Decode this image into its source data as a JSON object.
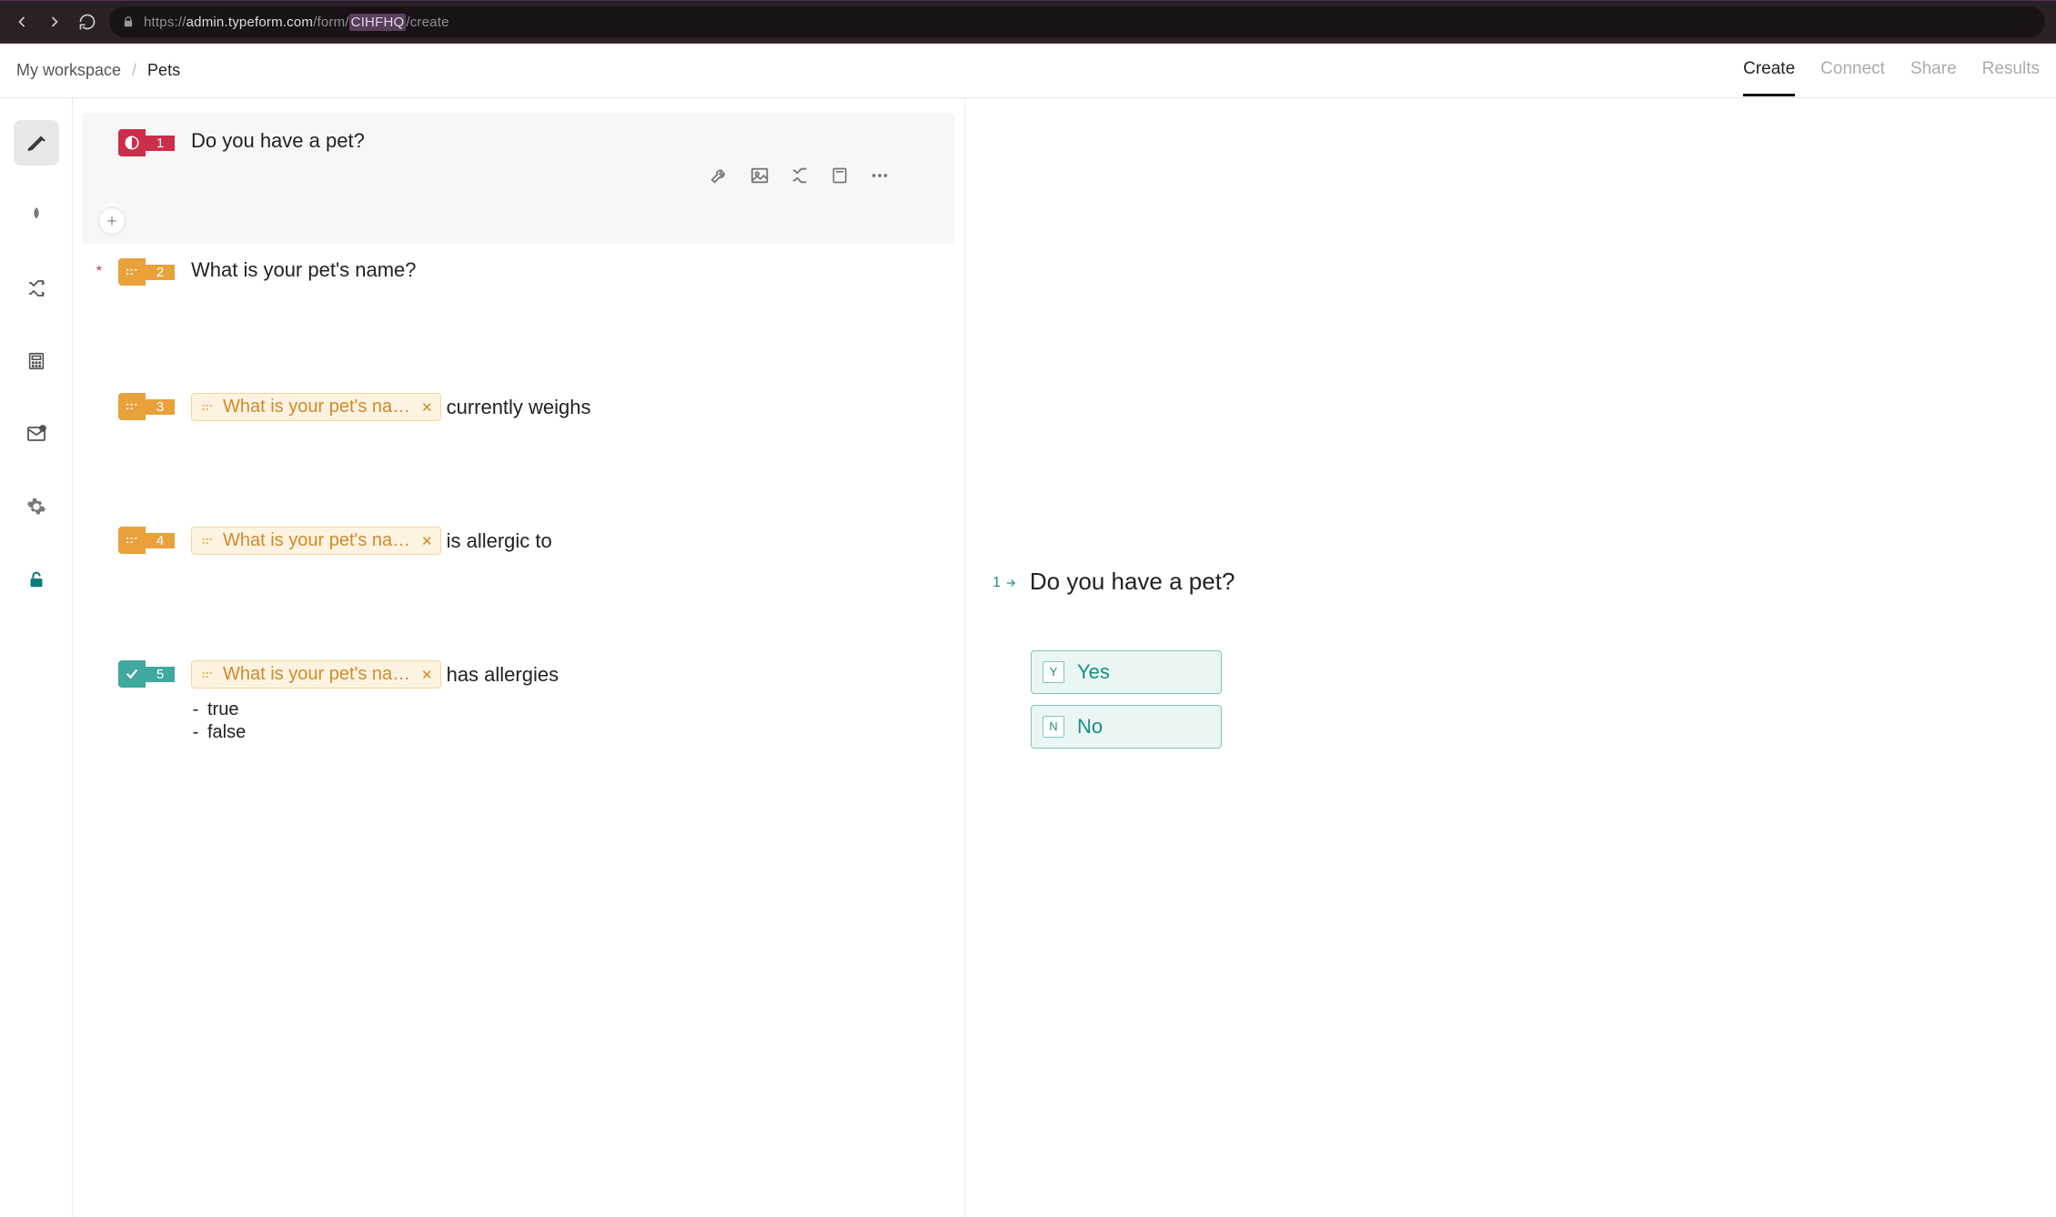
{
  "browser": {
    "url_prefix": "https://",
    "url_host": "admin.typeform.com",
    "url_path1": "/form/",
    "url_formid": "CIHFHQ",
    "url_path2": "/create"
  },
  "breadcrumb": {
    "workspace": "My workspace",
    "current": "Pets"
  },
  "tabs": {
    "create": "Create",
    "connect": "Connect",
    "share": "Share",
    "results": "Results"
  },
  "questions": [
    {
      "num": "1",
      "type": "yesno",
      "title": "Do you have a pet?",
      "required": false,
      "selected": true
    },
    {
      "num": "2",
      "type": "short",
      "title": "What is your pet's name?",
      "required": true
    },
    {
      "num": "3",
      "type": "short",
      "recall": "What is your pet's nam...",
      "suffix": "currently weighs"
    },
    {
      "num": "4",
      "type": "short",
      "recall": "What is your pet's nam...",
      "suffix": "is allergic to"
    },
    {
      "num": "5",
      "type": "bool",
      "recall": "What is your pet's nam...",
      "suffix": "has allergies",
      "options": [
        "true",
        "false"
      ]
    }
  ],
  "preview": {
    "number": "1",
    "title": "Do you have a pet?",
    "choices": [
      {
        "key": "Y",
        "label": "Yes"
      },
      {
        "key": "N",
        "label": "No"
      }
    ]
  }
}
